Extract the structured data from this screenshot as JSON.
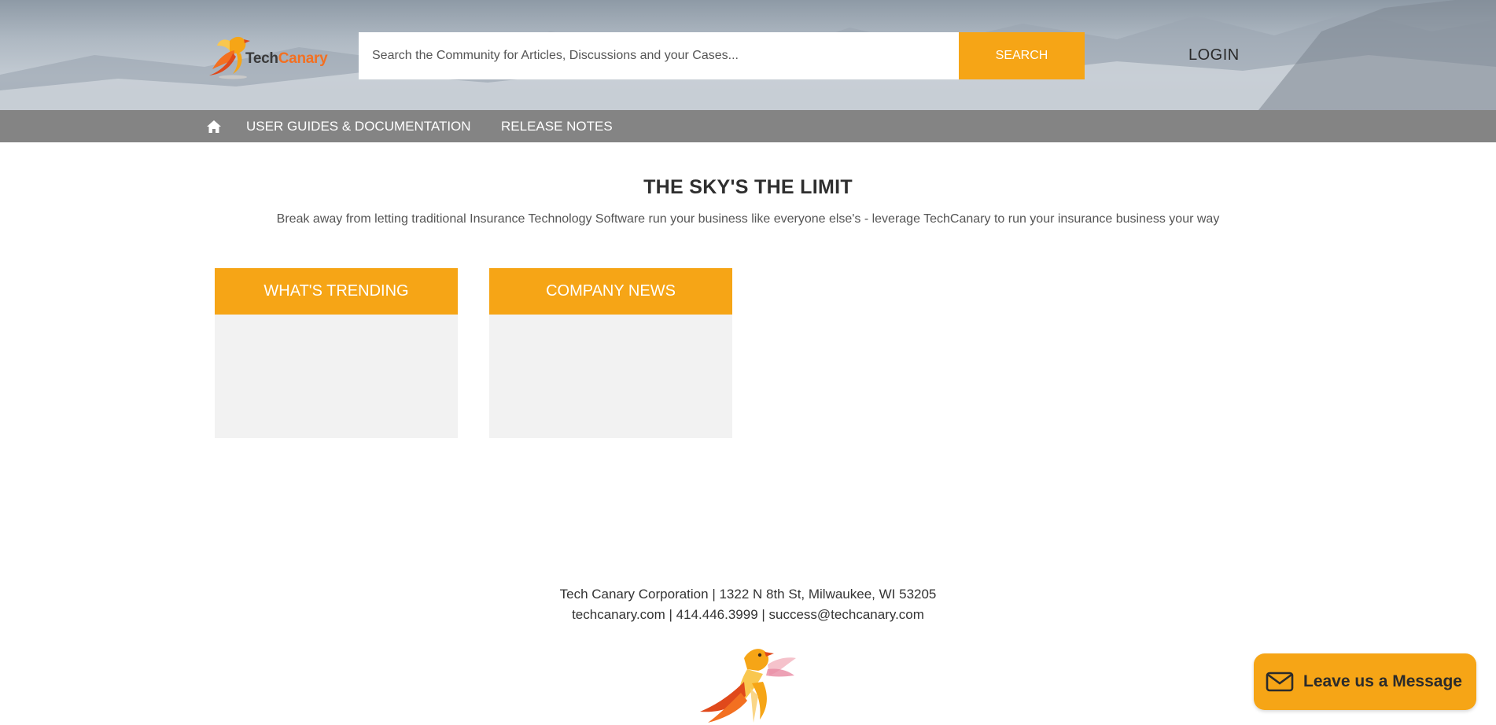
{
  "header": {
    "logo": {
      "tech": "Tech",
      "canary": "Canary"
    },
    "search": {
      "placeholder": "Search the Community for Articles, Discussions and your Cases...",
      "button_label": "SEARCH"
    },
    "login_label": "LOGIN"
  },
  "nav": {
    "home_icon": "home-icon",
    "items": [
      {
        "label": "USER GUIDES & DOCUMENTATION"
      },
      {
        "label": "RELEASE NOTES"
      }
    ]
  },
  "hero": {
    "title": "THE SKY'S THE LIMIT",
    "subtitle": "Break away from letting traditional Insurance Technology Software run your business like everyone else's - leverage TechCanary to run your insurance business your way"
  },
  "cards": [
    {
      "title": "WHAT'S TRENDING"
    },
    {
      "title": "COMPANY NEWS"
    }
  ],
  "footer": {
    "line1": "Tech Canary Corporation | 1322 N 8th St, Milwaukee, WI 53205",
    "line2": "techcanary.com | 414.446.3999 | success@techcanary.com"
  },
  "chat": {
    "label": "Leave us a Message",
    "icon": "envelope-icon"
  },
  "colors": {
    "accent": "#f6a516",
    "brand_orange": "#f37021",
    "nav_bg": "#6e6e6e"
  }
}
